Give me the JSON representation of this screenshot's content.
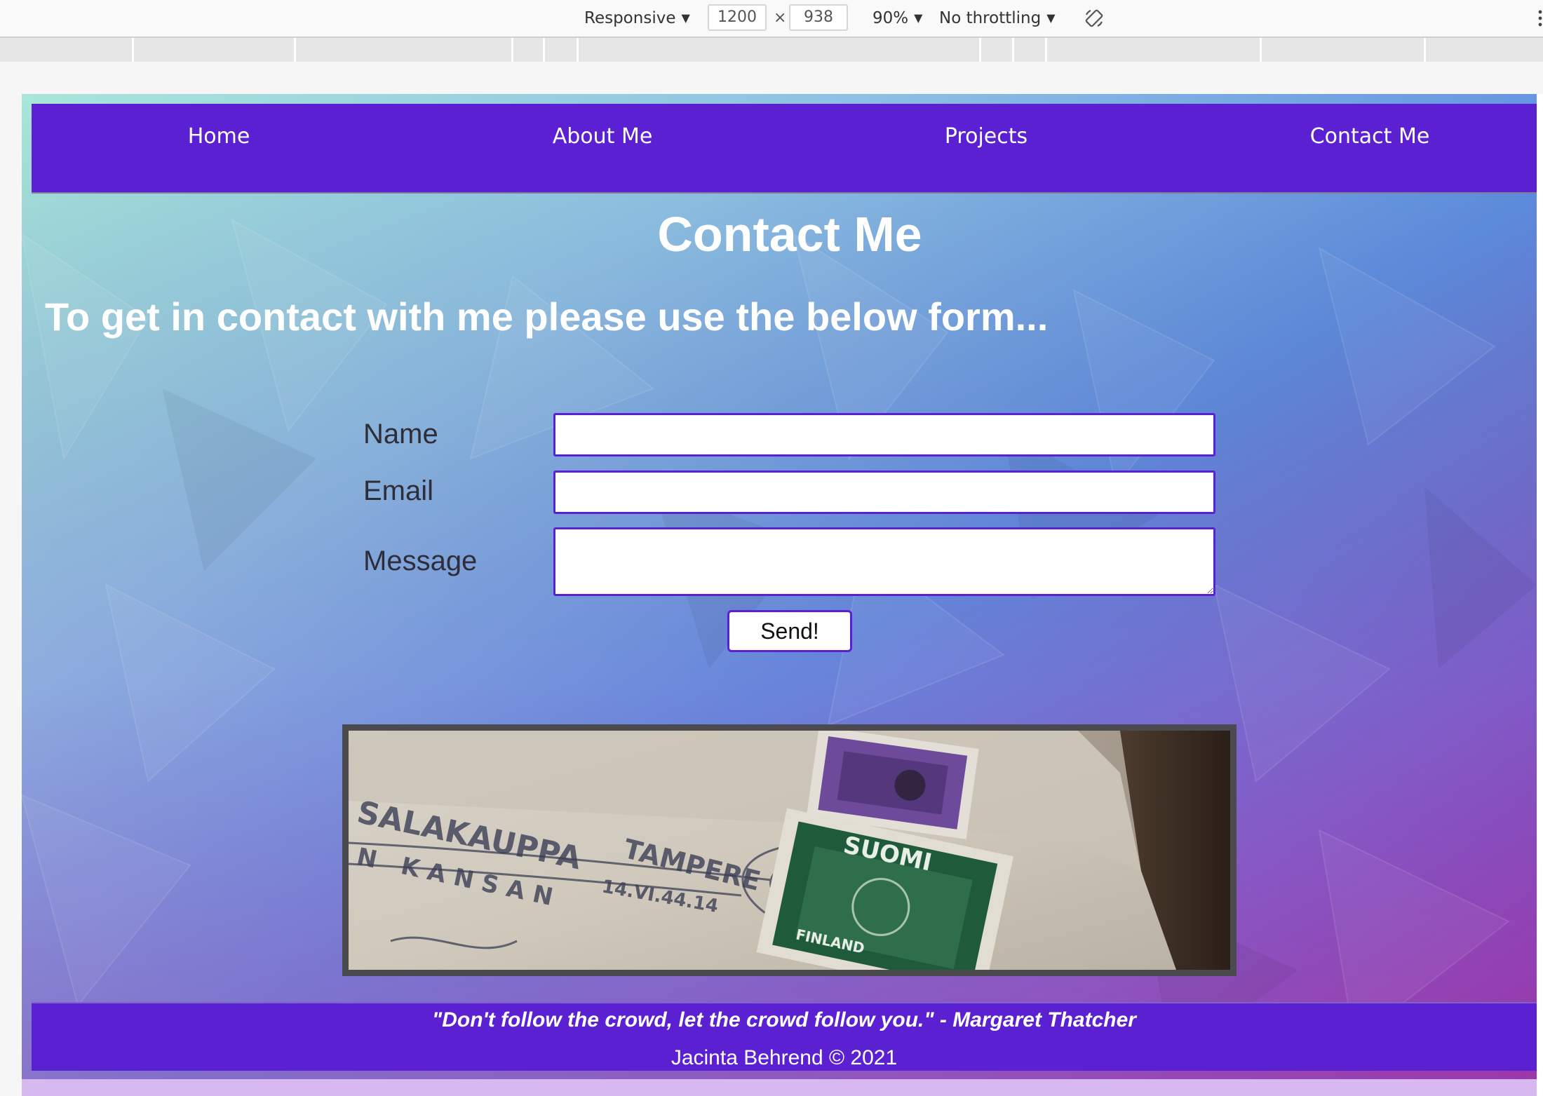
{
  "devtools": {
    "device": "Responsive",
    "width": "1200",
    "height": "938",
    "times": "×",
    "zoom": "90%",
    "throttling": "No throttling"
  },
  "nav": {
    "items": [
      "Home",
      "About Me",
      "Projects",
      "Contact Me"
    ]
  },
  "page": {
    "title": "Contact Me",
    "intro": "To get in contact with me please use the below form..."
  },
  "form": {
    "name_label": "Name",
    "email_label": "Email",
    "message_label": "Message",
    "name_value": "",
    "email_value": "",
    "message_value": "",
    "send_label": "Send!"
  },
  "image": {
    "stamp_text_1": "SALAKAUPPA",
    "stamp_text_2": "N KANSAN",
    "postmark_text": "TAMPERE",
    "postmark_date": "14.VI.44.14",
    "stamp_country": "SUOMI",
    "stamp_country_sub": "FINLAND"
  },
  "footer": {
    "quote": "\"Don't follow the crowd, let the crowd follow you.\" - Margaret Thatcher",
    "copyright": "Jacinta Behrend © 2021"
  },
  "colors": {
    "nav_bg": "#5a20d2",
    "field_border": "#5a20d2",
    "text_light": "#ffffff"
  }
}
